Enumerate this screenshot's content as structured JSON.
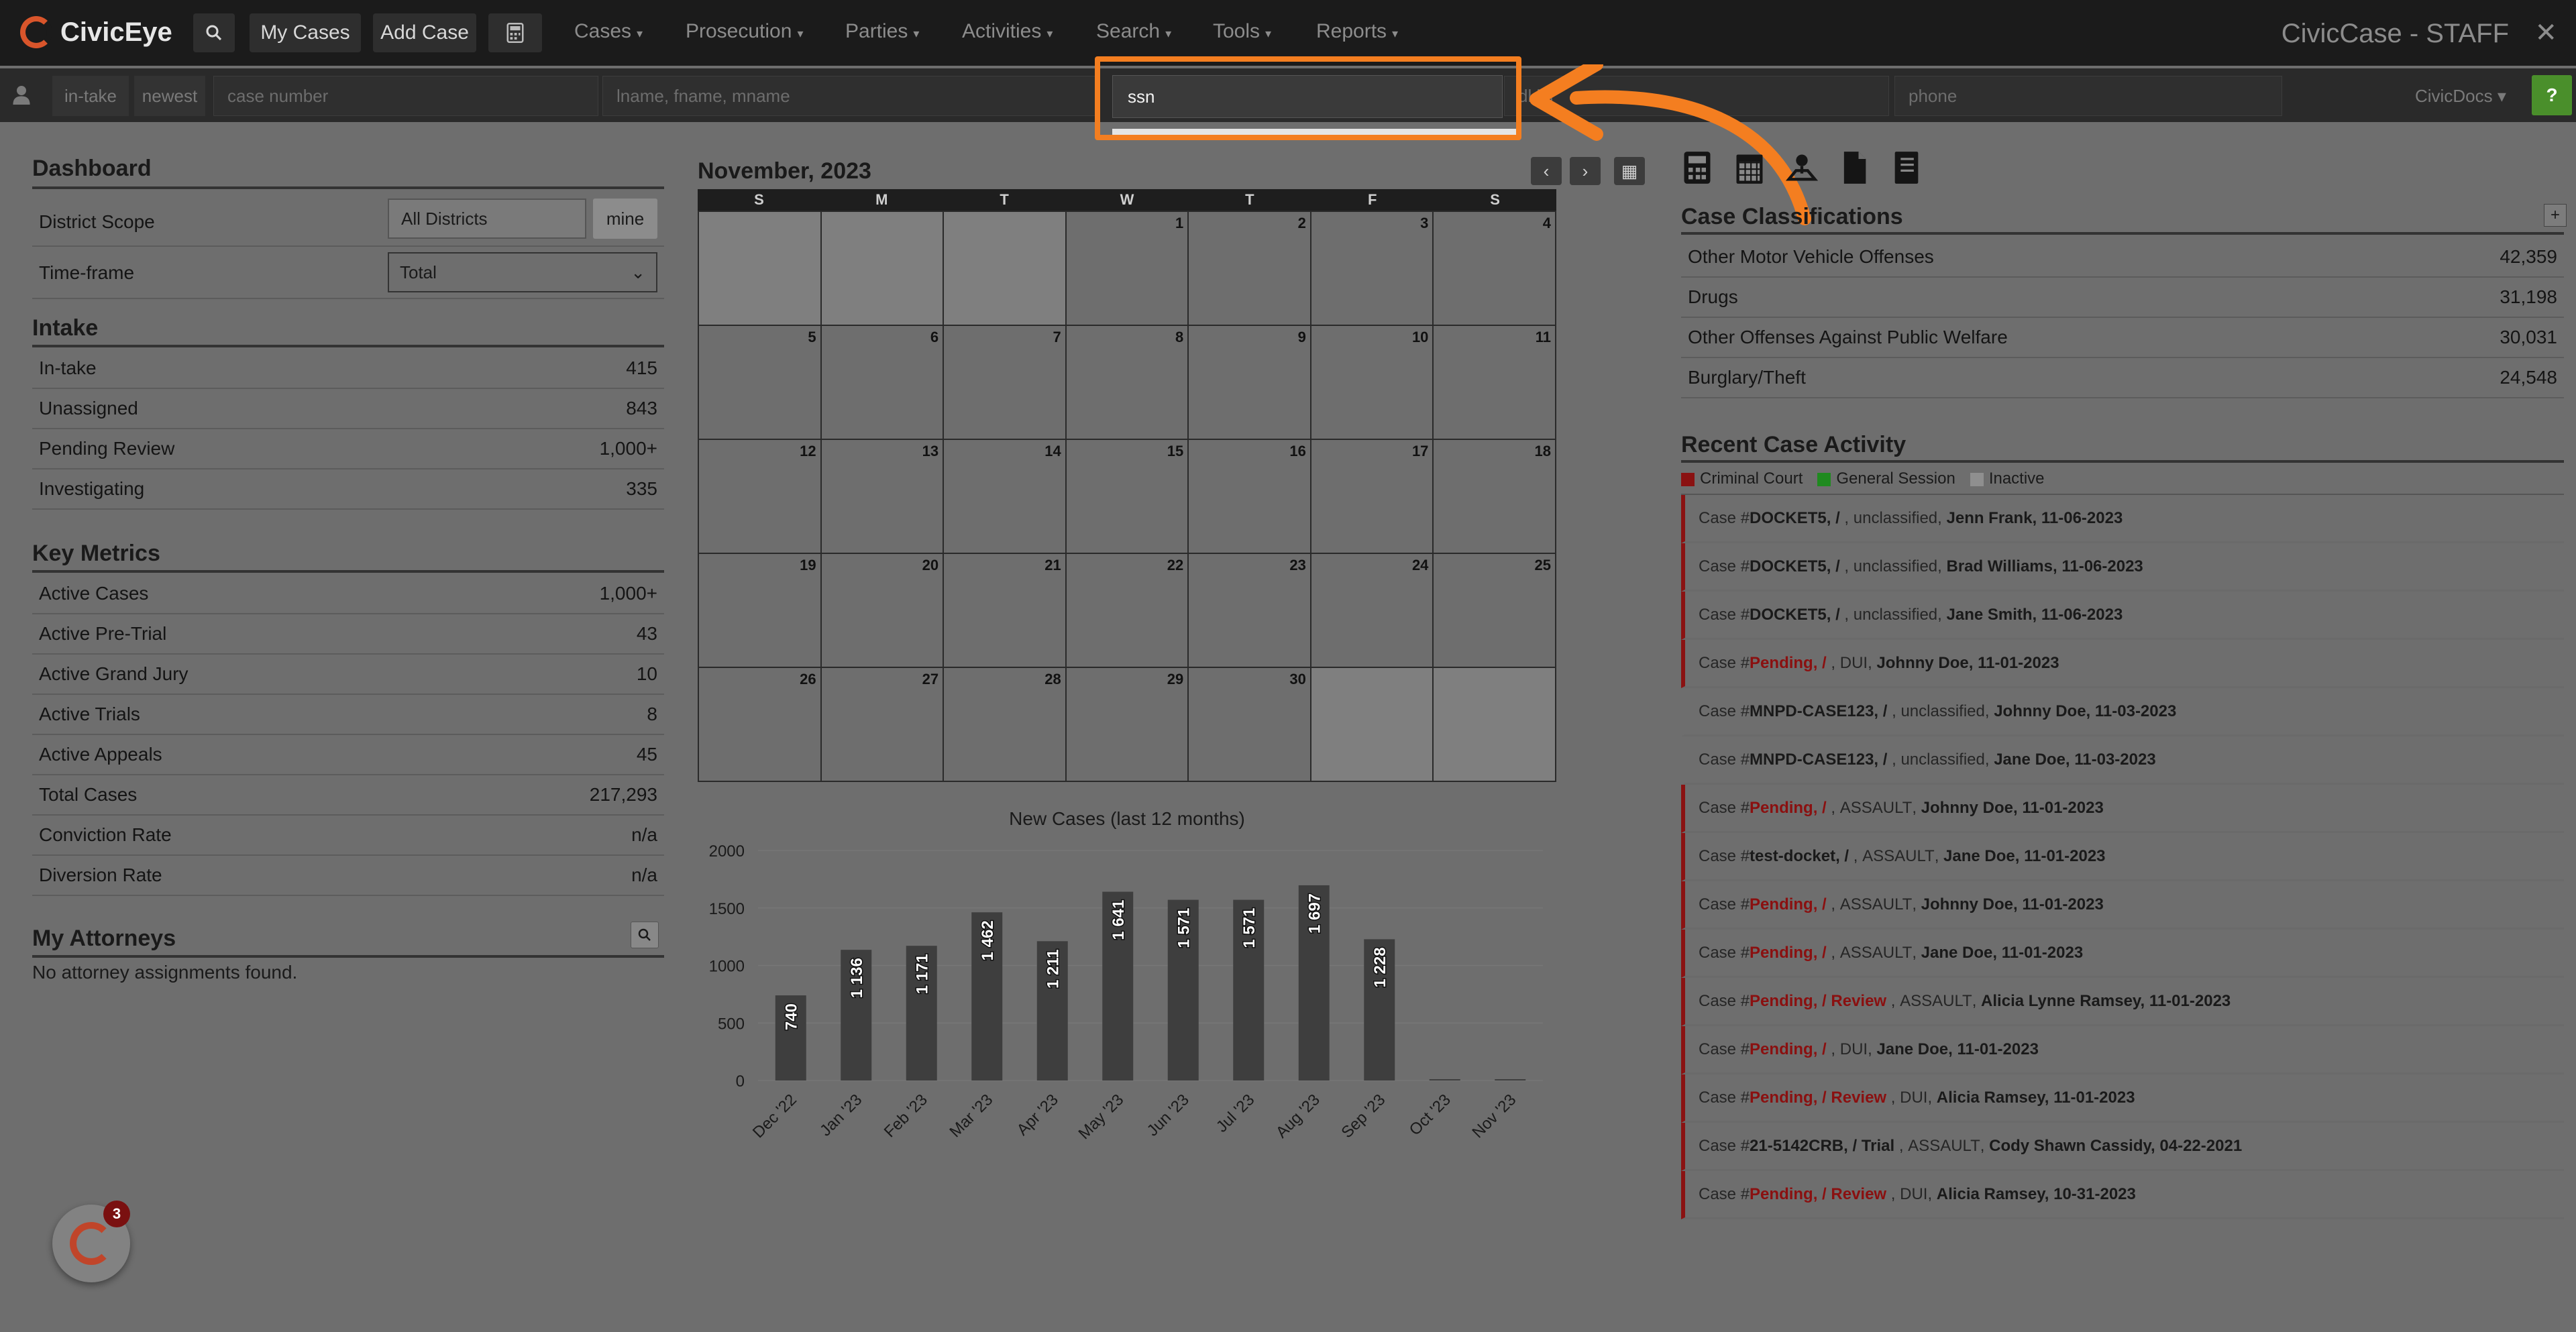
{
  "navbar": {
    "brand": "CivicEye",
    "my_cases": "My Cases",
    "add_case": "Add Case",
    "menus": [
      "Cases",
      "Prosecution",
      "Parties",
      "Activities",
      "Search",
      "Tools",
      "Reports"
    ],
    "app_title": "CivicCase - STAFF",
    "close": "✕"
  },
  "search": {
    "chip_intake": "in-take",
    "chip_newest": "newest",
    "case_number_placeholder": "case number",
    "name_placeholder": "lname, fname, mname",
    "ssn_value": "ssn",
    "dl_placeholder": "dl lis",
    "phone_placeholder": "phone",
    "civicdocs": "CivicDocs",
    "help": "?"
  },
  "dashboard": {
    "title": "Dashboard",
    "district_scope_label": "District Scope",
    "district_scope_value": "All Districts",
    "mine_label": "mine",
    "timeframe_label": "Time-frame",
    "timeframe_value": "Total"
  },
  "intake": {
    "title": "Intake",
    "rows": [
      {
        "label": "In-take",
        "value": "415"
      },
      {
        "label": "Unassigned",
        "value": "843"
      },
      {
        "label": "Pending Review",
        "value": "1,000+"
      },
      {
        "label": "Investigating",
        "value": "335"
      }
    ]
  },
  "key_metrics": {
    "title": "Key Metrics",
    "rows": [
      {
        "label": "Active Cases",
        "value": "1,000+"
      },
      {
        "label": "Active Pre-Trial",
        "value": "43"
      },
      {
        "label": "Active Grand Jury",
        "value": "10"
      },
      {
        "label": "Active Trials",
        "value": "8"
      },
      {
        "label": "Active Appeals",
        "value": "45"
      },
      {
        "label": "Total Cases",
        "value": "217,293"
      },
      {
        "label": "Conviction Rate",
        "value": "n/a"
      },
      {
        "label": "Diversion Rate",
        "value": "n/a"
      }
    ]
  },
  "attorneys": {
    "title": "My Attorneys",
    "empty": "No attorney assignments found."
  },
  "calendar": {
    "title": "November, 2023",
    "weekdays": [
      "S",
      "M",
      "T",
      "W",
      "T",
      "F",
      "S"
    ],
    "leading_blanks": 3,
    "days_in_month": 30
  },
  "classifications": {
    "title": "Case Classifications",
    "add": "+",
    "rows": [
      {
        "label": "Other Motor Vehicle Offenses",
        "value": "42,359"
      },
      {
        "label": "Drugs",
        "value": "31,198"
      },
      {
        "label": "Other Offenses Against Public Welfare",
        "value": "30,031"
      },
      {
        "label": "Burglary/Theft",
        "value": "24,548"
      }
    ]
  },
  "activity": {
    "title": "Recent Case Activity",
    "legend": [
      {
        "label": "Criminal Court",
        "color": "#8a1212"
      },
      {
        "label": "General Session",
        "color": "#1f8a1f"
      },
      {
        "label": "Inactive",
        "color": "#8f8f8f"
      }
    ],
    "rows": [
      {
        "docket": "DOCKET5, /",
        "pending": false,
        "cls": "unclassified",
        "person": "Jenn Frank, 11-06-2023",
        "inactive": false
      },
      {
        "docket": "DOCKET5, /",
        "pending": false,
        "cls": "unclassified",
        "person": "Brad Williams, 11-06-2023",
        "inactive": false
      },
      {
        "docket": "DOCKET5, /",
        "pending": false,
        "cls": "unclassified",
        "person": "Jane Smith, 11-06-2023",
        "inactive": false
      },
      {
        "docket": "Pending, /",
        "pending": true,
        "cls": "DUI",
        "person": "Johnny Doe, 11-01-2023",
        "inactive": false
      },
      {
        "docket": "MNPD-CASE123, /",
        "pending": false,
        "cls": "unclassified",
        "person": "Johnny Doe, 11-03-2023",
        "inactive": true
      },
      {
        "docket": "MNPD-CASE123, /",
        "pending": false,
        "cls": "unclassified",
        "person": "Jane Doe, 11-03-2023",
        "inactive": true
      },
      {
        "docket": "Pending, /",
        "pending": true,
        "cls": "ASSAULT",
        "person": "Johnny Doe, 11-01-2023",
        "inactive": false
      },
      {
        "docket": "test-docket, /",
        "pending": false,
        "cls": "ASSAULT",
        "person": "Jane Doe, 11-01-2023",
        "inactive": false
      },
      {
        "docket": "Pending, /",
        "pending": true,
        "cls": "ASSAULT",
        "person": "Johnny Doe, 11-01-2023",
        "inactive": false
      },
      {
        "docket": "Pending, /",
        "pending": true,
        "cls": "ASSAULT",
        "person": "Jane Doe, 11-01-2023",
        "inactive": false
      },
      {
        "docket": "Pending, / Review",
        "pending": true,
        "cls": "ASSAULT",
        "person": "Alicia Lynne Ramsey, 11-01-2023",
        "inactive": false
      },
      {
        "docket": "Pending, /",
        "pending": true,
        "cls": "DUI",
        "person": "Jane Doe, 11-01-2023",
        "inactive": false
      },
      {
        "docket": "Pending, / Review",
        "pending": true,
        "cls": "DUI",
        "person": "Alicia Ramsey, 11-01-2023",
        "inactive": false
      },
      {
        "docket": "21-5142CRB, / Trial",
        "pending": false,
        "cls": "ASSAULT",
        "person": "Cody Shawn Cassidy, 04-22-2021",
        "inactive": false
      },
      {
        "docket": "Pending, / Review",
        "pending": true,
        "cls": "DUI",
        "person": "Alicia Ramsey, 10-31-2023",
        "inactive": false
      }
    ]
  },
  "notifications": {
    "count": "3"
  },
  "chart_data": {
    "type": "bar",
    "title": "New Cases (last 12 months)",
    "categories": [
      "Dec '22",
      "Jan '23",
      "Feb '23",
      "Mar '23",
      "Apr '23",
      "May '23",
      "Jun '23",
      "Jul '23",
      "Aug '23",
      "Sep '23",
      "Oct '23",
      "Nov '23"
    ],
    "values": [
      740,
      1136,
      1171,
      1462,
      1211,
      1641,
      1571,
      1571,
      1697,
      1228,
      0,
      0
    ],
    "labels": [
      "740",
      "1 136",
      "1 171",
      "1 462",
      "1 211",
      "1 641",
      "1 571",
      "1 571",
      "1 697",
      "1 228",
      "",
      ""
    ],
    "ylim": [
      0,
      2000
    ],
    "yticks": [
      0,
      500,
      1000,
      1500,
      2000
    ],
    "bar_color": "#3e3e3e",
    "grid": true
  }
}
